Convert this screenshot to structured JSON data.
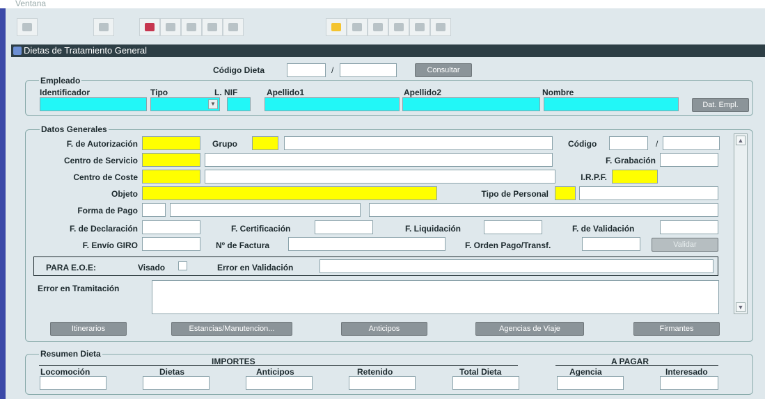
{
  "menu": {
    "ventana": "Ventana"
  },
  "window": {
    "title": "Dietas de Tratamiento General"
  },
  "header": {
    "codigo_dieta_label": "Código Dieta",
    "slash": "/",
    "consultar_label": "Consultar"
  },
  "empleado": {
    "section": "Empleado",
    "identificador": "Identificador",
    "tipo": "Tipo",
    "lnif": "L. NIF",
    "apellido1": "Apellido1",
    "apellido2": "Apellido2",
    "nombre": "Nombre",
    "dat_empl": "Dat. Empl."
  },
  "generales": {
    "section": "Datos Generales",
    "f_autorizacion": "F. de Autorización",
    "grupo": "Grupo",
    "codigo": "Código",
    "slash": "/",
    "centro_servicio": "Centro de Servicio",
    "f_grabacion": "F. Grabación",
    "centro_coste": "Centro de Coste",
    "irpf": "I.R.P.F.",
    "objeto": "Objeto",
    "tipo_personal": "Tipo de Personal",
    "forma_pago": "Forma de Pago",
    "f_declaracion": "F. de Declaración",
    "f_certificacion": "F. Certificación",
    "f_liquidacion": "F. Liquidación",
    "f_validacion": "F. de Validación",
    "f_envio_giro": "F. Envío GIRO",
    "n_factura": "Nº de Factura",
    "f_orden_pago": "F. Orden Pago/Transf.",
    "validar": "Validar",
    "para_eoe": "PARA E.O.E:",
    "visado": "Visado",
    "error_validacion": "Error en Validación",
    "error_tramitacion": "Error en Tramitación"
  },
  "buttons": {
    "itinerarios": "Itinerarios",
    "estancias": "Estancias/Manutencion...",
    "anticipos": "Anticipos",
    "agencias": "Agencias de Viaje",
    "firmantes": "Firmantes"
  },
  "resumen": {
    "section": "Resumen Dieta",
    "importes": "IMPORTES",
    "a_pagar": "A  PAGAR",
    "locomocion": "Locomoción",
    "dietas": "Dietas",
    "anticipos": "Anticipos",
    "retenido": "Retenido",
    "total_dieta": "Total Dieta",
    "agencia": "Agencia",
    "interesado": "Interesado"
  },
  "colors": {
    "accent_cyan": "#22f7f7",
    "required_yellow": "#ffff00",
    "titlebar": "#2d3e45"
  }
}
